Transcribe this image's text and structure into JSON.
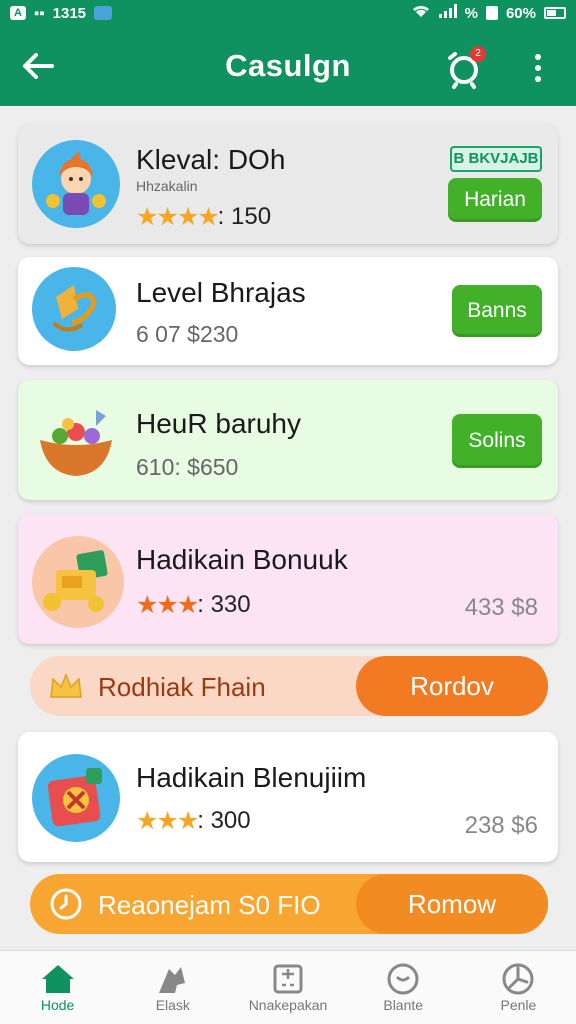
{
  "status_bar": {
    "time": "1315",
    "battery": "60%",
    "signal_text": "%"
  },
  "app_bar": {
    "title": "Casulgn",
    "notification_count": "2"
  },
  "cards": [
    {
      "title": "Kleval: DOh",
      "subtitle": "Hhzakalin",
      "rating_text": ": 150",
      "badge": "B BKVJAJB",
      "button": "Harian"
    },
    {
      "title": "Level Bhrajas",
      "subtitle": "6 07 $230",
      "button": "Banns"
    },
    {
      "title": "HeuR baruhy",
      "subtitle": "610: $650",
      "button": "Solins"
    },
    {
      "title": "Hadikain Bonuuk",
      "rating_text": ": 330",
      "price": "433 $8"
    },
    {
      "title": "Hadikain Blenujiim",
      "rating_text": ": 300",
      "price": "238 $6"
    }
  ],
  "pills": [
    {
      "label": "Rodhiak Fhain",
      "button": "Rordov"
    },
    {
      "label": "Reaonejam S0 FIO",
      "button": "Romow"
    }
  ],
  "bottom_nav": [
    {
      "label": "Hode"
    },
    {
      "label": "Elask"
    },
    {
      "label": "Nnakepakan"
    },
    {
      "label": "Blante"
    },
    {
      "label": "Penle"
    }
  ],
  "colors": {
    "primary": "#0f9160",
    "green_button": "#43b02a",
    "orange_button": "#f27a22",
    "amber_pill": "#f8a531",
    "pink_card": "#fce4f4",
    "mint_card": "#e8fbe3"
  }
}
